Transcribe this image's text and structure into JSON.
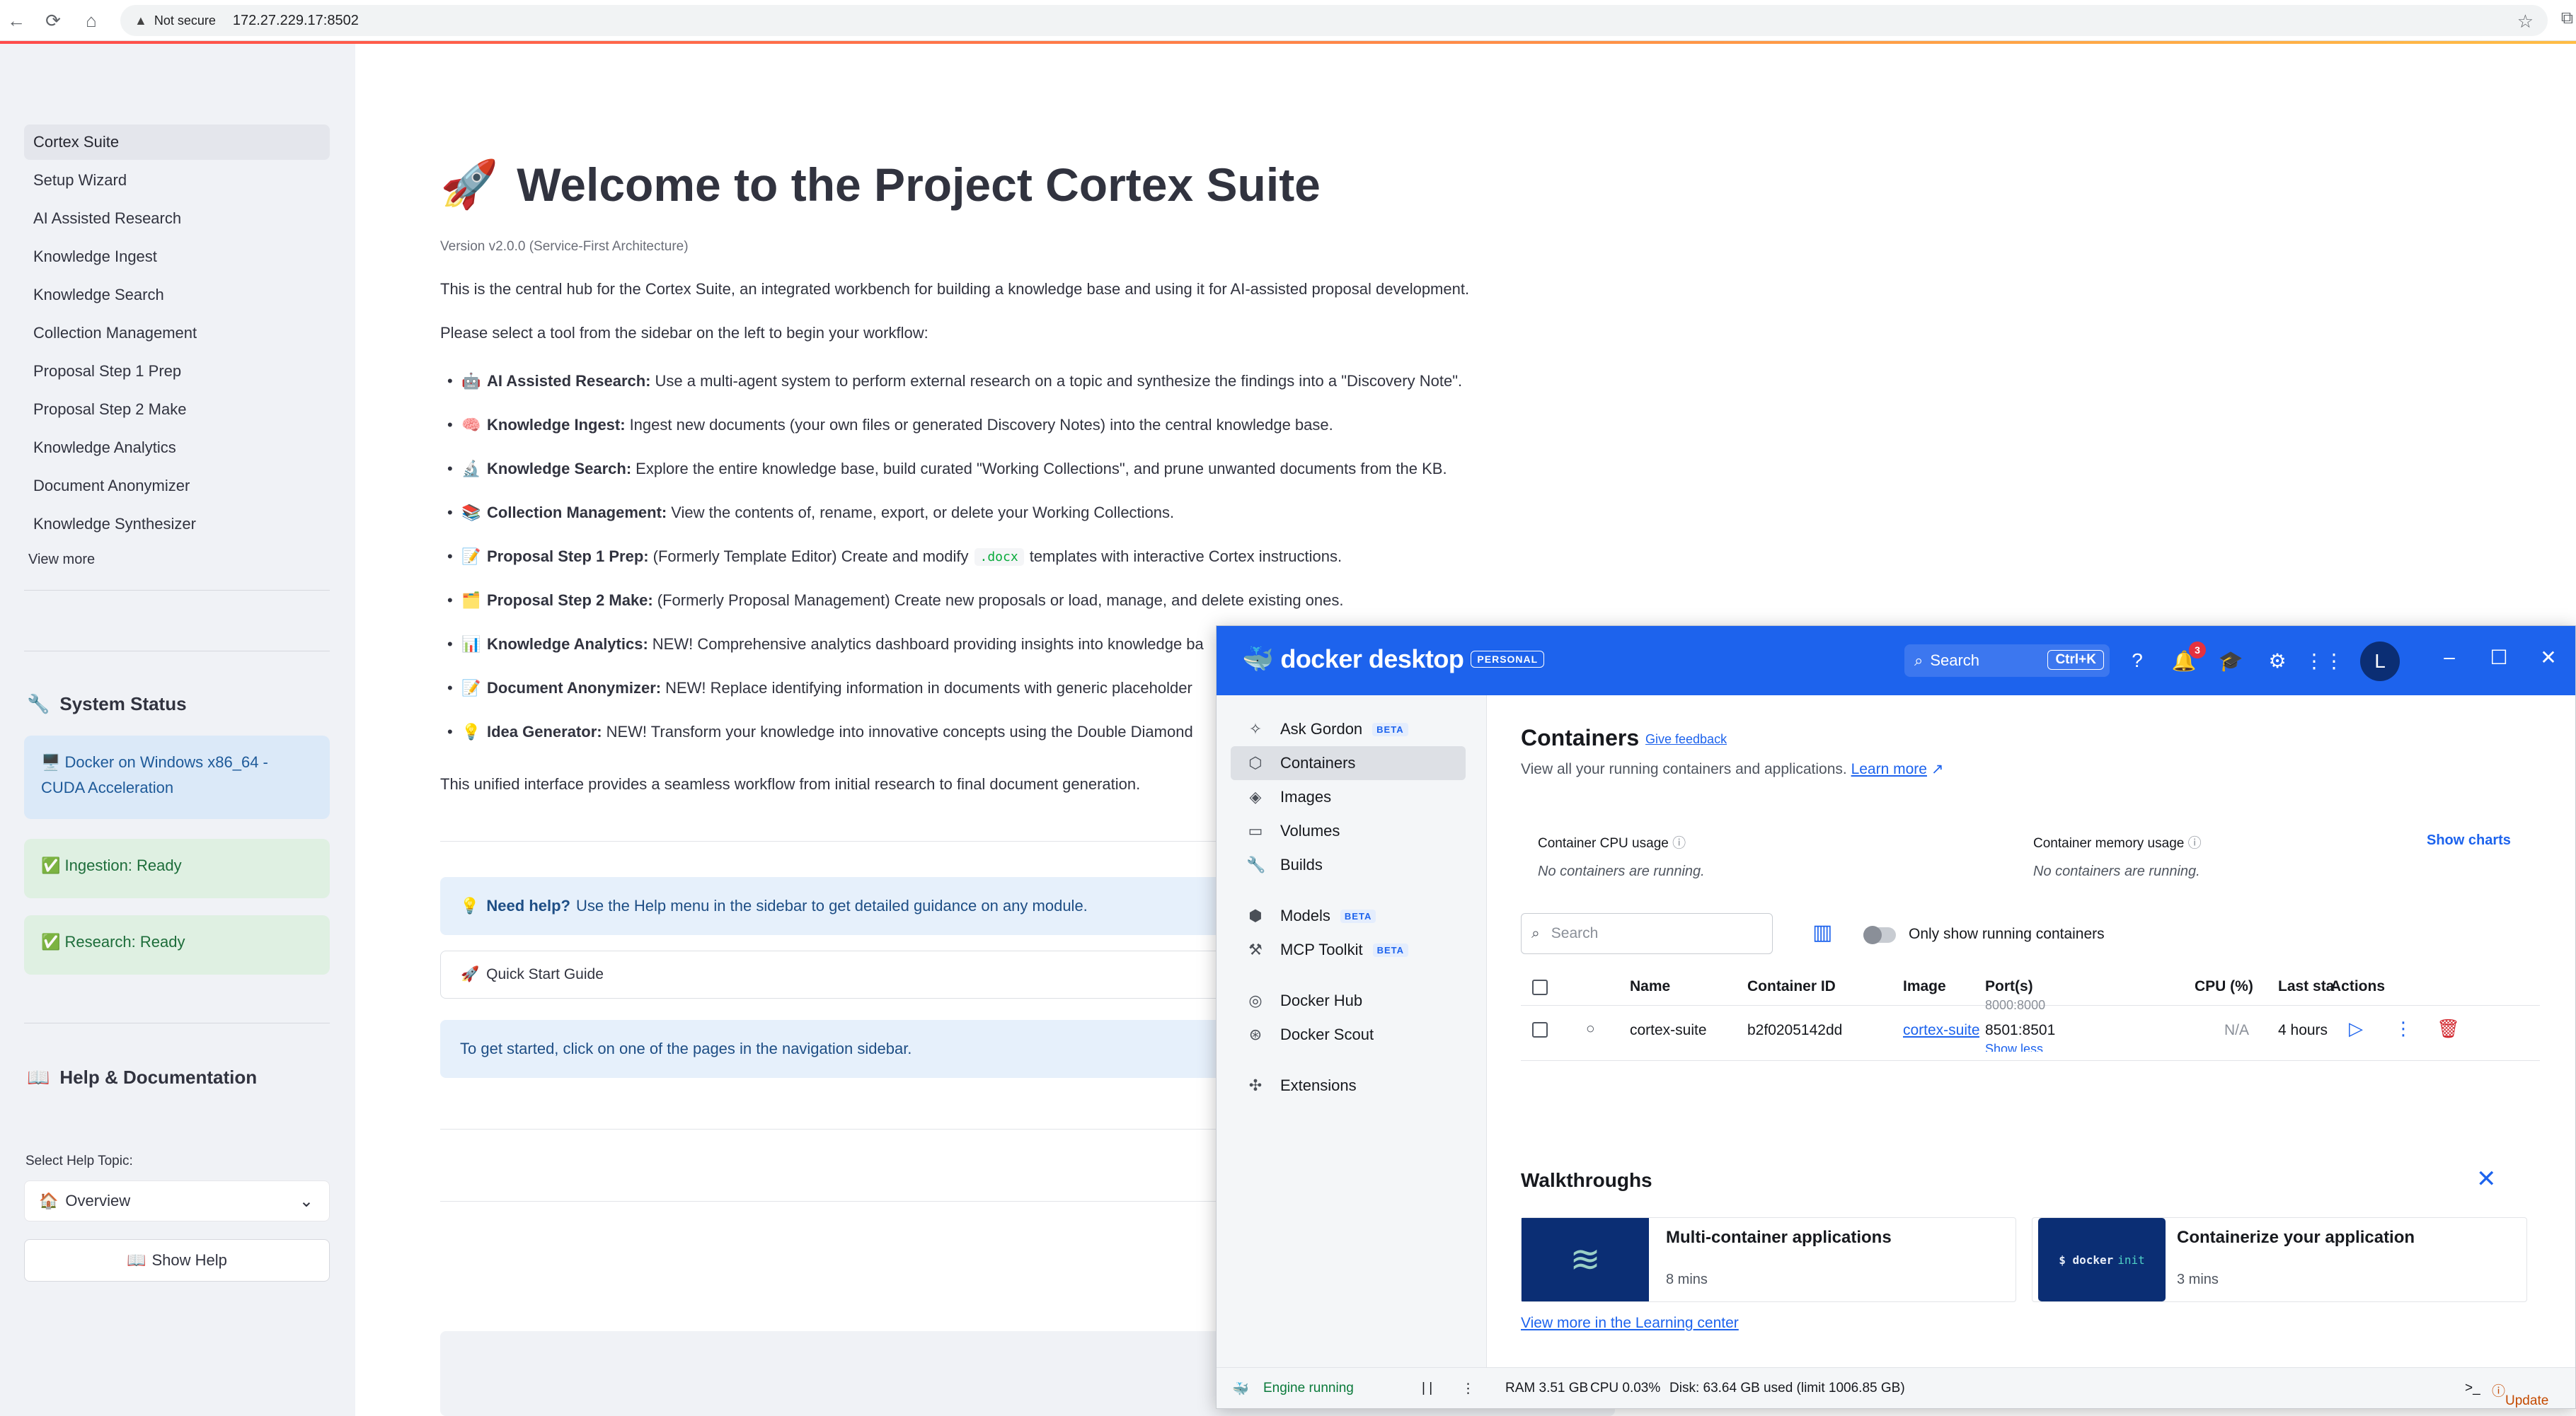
{
  "browser": {
    "security_label": "Not secure",
    "url": "172.27.229.17:8502"
  },
  "sidebar": {
    "items": [
      {
        "label": "Cortex Suite",
        "active": true
      },
      {
        "label": "Setup Wizard"
      },
      {
        "label": "AI Assisted Research"
      },
      {
        "label": "Knowledge Ingest"
      },
      {
        "label": "Knowledge Search"
      },
      {
        "label": "Collection Management"
      },
      {
        "label": "Proposal Step 1 Prep"
      },
      {
        "label": "Proposal Step 2 Make"
      },
      {
        "label": "Knowledge Analytics"
      },
      {
        "label": "Document Anonymizer"
      },
      {
        "label": "Knowledge Synthesizer"
      }
    ],
    "view_more": "View more",
    "system_status": {
      "heading": "System Status",
      "docker": "Docker on Windows x86_64 - CUDA Acceleration",
      "ingestion": "Ingestion: Ready",
      "research": "Research: Ready"
    },
    "help": {
      "heading": "Help & Documentation",
      "select_label": "Select Help Topic:",
      "selected": "Overview",
      "button": "Show Help"
    }
  },
  "main": {
    "title": "Welcome to the Project Cortex Suite",
    "version": "Version v2.0.0 (Service-First Architecture)",
    "intro": "This is the central hub for the Cortex Suite, an integrated workbench for building a knowledge base and using it for AI-assisted proposal development.",
    "instruction": "Please select a tool from the sidebar on the left to begin your workflow:",
    "tools": [
      {
        "name": "AI Assisted Research:",
        "desc": "Use a multi-agent system to perform external research on a topic and synthesize the findings into a \"Discovery Note\"."
      },
      {
        "name": "Knowledge Ingest:",
        "desc": "Ingest new documents (your own files or generated Discovery Notes) into the central knowledge base."
      },
      {
        "name": "Knowledge Search:",
        "desc": "Explore the entire knowledge base, build curated \"Working Collections\", and prune unwanted documents from the KB."
      },
      {
        "name": "Collection Management:",
        "desc": "View the contents of, rename, export, or delete your Working Collections."
      },
      {
        "name": "Proposal Step 1 Prep:",
        "desc": "(Formerly Template Editor) Create and modify",
        "code": ".docx",
        "desc2": "templates with interactive Cortex instructions."
      },
      {
        "name": "Proposal Step 2 Make:",
        "desc": "(Formerly Proposal Management) Create new proposals or load, manage, and delete existing ones."
      },
      {
        "name": "Knowledge Analytics:",
        "desc": "NEW! Comprehensive analytics dashboard providing insights into knowledge ba"
      },
      {
        "name": "Document Anonymizer:",
        "desc": "NEW! Replace identifying information in documents with generic placeholder"
      },
      {
        "name": "Idea Generator:",
        "desc": "NEW! Transform your knowledge into innovative concepts using the Double Diamond"
      }
    ],
    "outro": "This unified interface provides a seamless workflow from initial research to final document generation.",
    "help_box": {
      "bold": "Need help?",
      "text": "Use the Help menu in the sidebar to get detailed guidance on any module."
    },
    "quick_start": "Quick Start Guide",
    "start_box": "To get started, click on one of the pages in the navigation sidebar."
  },
  "docker": {
    "brand": "docker desktop",
    "plan": "PERSONAL",
    "search_label": "Search",
    "search_shortcut": "Ctrl+K",
    "notification_count": "3",
    "avatar_letter": "L",
    "nav": [
      {
        "label": "Ask Gordon",
        "beta": "BETA",
        "icon": "sparkle"
      },
      {
        "label": "Containers",
        "icon": "container",
        "active": true
      },
      {
        "label": "Images",
        "icon": "image"
      },
      {
        "label": "Volumes",
        "icon": "volume"
      },
      {
        "label": "Builds",
        "icon": "wrench"
      },
      {
        "label": "Models",
        "beta": "BETA",
        "icon": "cube"
      },
      {
        "label": "MCP Toolkit",
        "beta": "BETA",
        "icon": "toolkit"
      },
      {
        "label": "Docker Hub",
        "icon": "hub"
      },
      {
        "label": "Docker Scout",
        "icon": "scout"
      },
      {
        "label": "Extensions",
        "icon": "puzzle"
      }
    ],
    "containers": {
      "title": "Containers",
      "feedback": "Give feedback",
      "subtitle": "View all your running containers and applications.",
      "learn_more": "Learn more",
      "cpu_label": "Container CPU usage",
      "cpu_value": "No containers are running.",
      "mem_label": "Container memory usage",
      "mem_value": "No containers are running.",
      "show_charts": "Show charts",
      "search_placeholder": "Search",
      "toggle_label": "Only show running containers",
      "columns": [
        "Name",
        "Container ID",
        "Image",
        "Port(s)",
        "CPU (%)",
        "Last sta",
        "Actions"
      ],
      "row": {
        "name": "cortex-suite",
        "id": "b2f0205142dd",
        "image": "cortex-suite",
        "port_top": "8000:8000",
        "port": "8501:8501",
        "port_more": "Show less",
        "cpu": "N/A",
        "last_started": "4 hours a"
      }
    },
    "walkthroughs": {
      "title": "Walkthroughs",
      "cards": [
        {
          "title": "Multi-container applications",
          "meta": "8 mins"
        },
        {
          "title": "Containerize your application",
          "meta": "3 mins",
          "code_prefix": "$ docker",
          "code_cmd": "init"
        }
      ],
      "learn_link": "View more in the Learning center"
    },
    "footer": {
      "engine": "Engine running",
      "ram": "RAM 3.51 GB",
      "cpu": "CPU 0.03%",
      "disk": "Disk: 63.64 GB used (limit 1006.85 GB)",
      "update": "Update"
    }
  }
}
